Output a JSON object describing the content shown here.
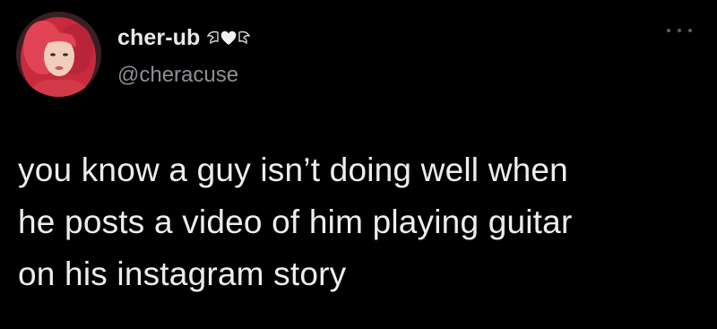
{
  "author": {
    "display_name": "cher-ub",
    "handle": "@cheracuse",
    "name_badge_icon": "heart-wings-icon",
    "avatar_icon": "profile-avatar"
  },
  "menu": {
    "icon": "more-options-icon"
  },
  "tweet": {
    "lines": [
      "you know a guy isn’t doing well when",
      "he posts a video of him playing guitar",
      "on his instagram story"
    ]
  },
  "colors": {
    "background": "#000000",
    "text": "#e7e9ea",
    "secondary_text": "#8b9096",
    "avatar_hair": "#d9384a"
  }
}
